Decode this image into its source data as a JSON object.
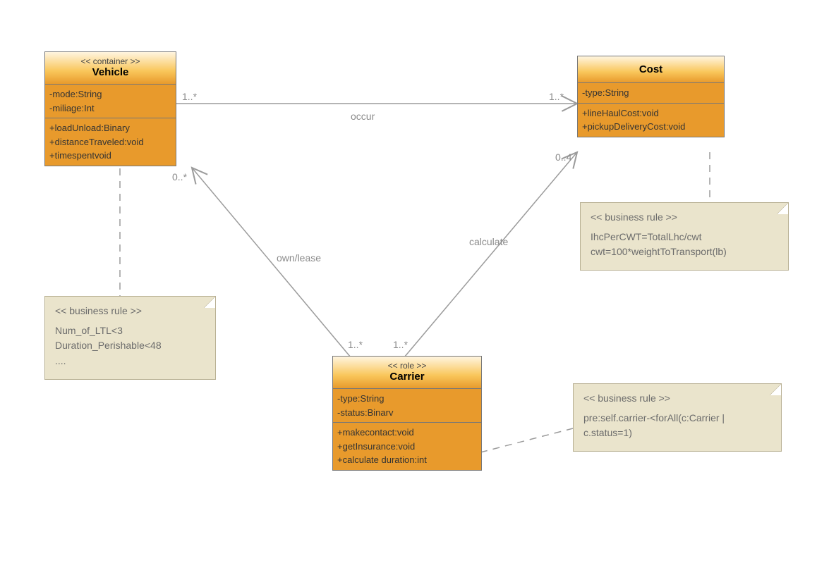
{
  "classes": {
    "vehicle": {
      "stereo": "<< container >>",
      "name": "Vehicle",
      "attrs": [
        "-mode:String",
        "-miliage:Int"
      ],
      "ops": [
        "+loadUnload:Binary",
        "+distanceTraveled:void",
        "+timespentvoid"
      ]
    },
    "cost": {
      "name": "Cost",
      "attrs": [
        "-type:String"
      ],
      "ops": [
        "+lineHaulCost:void",
        "+pickupDeliveryCost:void"
      ]
    },
    "carrier": {
      "stereo": "<< role >>",
      "name": "Carrier",
      "attrs": [
        "-type:String",
        "-status:Binarv"
      ],
      "ops": [
        "+makecontact:void",
        "+getInsurance:void",
        "+calculate duration:int"
      ]
    }
  },
  "notes": {
    "vehicleRule": {
      "stereo": "<< business rule >>",
      "lines": [
        "Num_of_LTL<3",
        "Duration_Perishable<48",
        "...."
      ]
    },
    "costRule": {
      "stereo": "<< business rule >>",
      "lines": [
        "IhcPerCWT=TotalLhc/cwt",
        "cwt=100*weightToTransport(lb)"
      ]
    },
    "carrierRule": {
      "stereo": "<< business rule >>",
      "lines": [
        "pre:self.carrier-<forAll(c:Carrier |",
        "c.status=1)"
      ]
    }
  },
  "labels": {
    "occur": "occur",
    "ownlease": "own/lease",
    "calculate": "calculate",
    "m1": "1..*",
    "m2": "1..*",
    "m3": "0..*",
    "m4": "1..*",
    "m5": "1..*",
    "m6": "0..4"
  }
}
